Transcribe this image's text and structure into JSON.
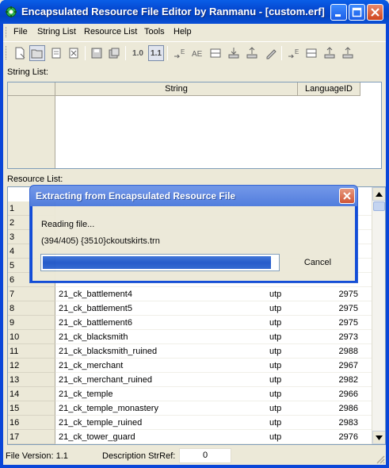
{
  "window": {
    "title": "Encapsulated Resource File Editor by Ranmanu - [custom.erf]"
  },
  "menu": {
    "items": [
      "File",
      "String List",
      "Resource List",
      "Tools",
      "Help"
    ]
  },
  "toolbar": {
    "zoom_10": "1.0",
    "zoom_11": "1.1",
    "icons": [
      "new-erf-icon",
      "open-erf-icon",
      "save-icon",
      "close-doc-icon",
      "save-disk-icon",
      "save-as-icon",
      "add-string-icon",
      "edit-string-icon",
      "delete-string-icon",
      "import-icon",
      "export-icon",
      "rename-icon",
      "add-resource-icon",
      "edit-resource-icon",
      "import-resource-icon",
      "export-resource-icon"
    ]
  },
  "string_list": {
    "label": "String List:",
    "columns": [
      "String",
      "LanguageID"
    ]
  },
  "resource_list": {
    "label": "Resource List:",
    "rows": [
      {
        "num": "1",
        "name": "",
        "type": "",
        "size": ""
      },
      {
        "num": "2",
        "name": "",
        "type": "",
        "size": ""
      },
      {
        "num": "3",
        "name": "",
        "type": "",
        "size": ""
      },
      {
        "num": "4",
        "name": "",
        "type": "",
        "size": ""
      },
      {
        "num": "5",
        "name": "",
        "type": "",
        "size": ""
      },
      {
        "num": "6",
        "name": "",
        "type": "",
        "size": ""
      },
      {
        "num": "7",
        "name": "21_ck_battlement4",
        "type": "utp",
        "size": "2975"
      },
      {
        "num": "8",
        "name": "21_ck_battlement5",
        "type": "utp",
        "size": "2975"
      },
      {
        "num": "9",
        "name": "21_ck_battlement6",
        "type": "utp",
        "size": "2975"
      },
      {
        "num": "10",
        "name": "21_ck_blacksmith",
        "type": "utp",
        "size": "2973"
      },
      {
        "num": "11",
        "name": "21_ck_blacksmith_ruined",
        "type": "utp",
        "size": "2988"
      },
      {
        "num": "12",
        "name": "21_ck_merchant",
        "type": "utp",
        "size": "2967"
      },
      {
        "num": "13",
        "name": "21_ck_merchant_ruined",
        "type": "utp",
        "size": "2982"
      },
      {
        "num": "14",
        "name": "21_ck_temple",
        "type": "utp",
        "size": "2966"
      },
      {
        "num": "15",
        "name": "21_ck_temple_monastery",
        "type": "utp",
        "size": "2986"
      },
      {
        "num": "16",
        "name": "21_ck_temple_ruined",
        "type": "utp",
        "size": "2983"
      },
      {
        "num": "17",
        "name": "21_ck_tower_guard",
        "type": "utp",
        "size": "2976"
      }
    ]
  },
  "dialog": {
    "title": "Extracting from Encapsulated Resource File",
    "status": "Reading file...",
    "detail": "(394/405) {3510}ckoutskirts.trn",
    "progress_fraction": 0.973,
    "cancel_label": "Cancel"
  },
  "status": {
    "file_version": "File Version: 1.1",
    "desc_label": "Description StrRef:",
    "desc_value": "0"
  }
}
